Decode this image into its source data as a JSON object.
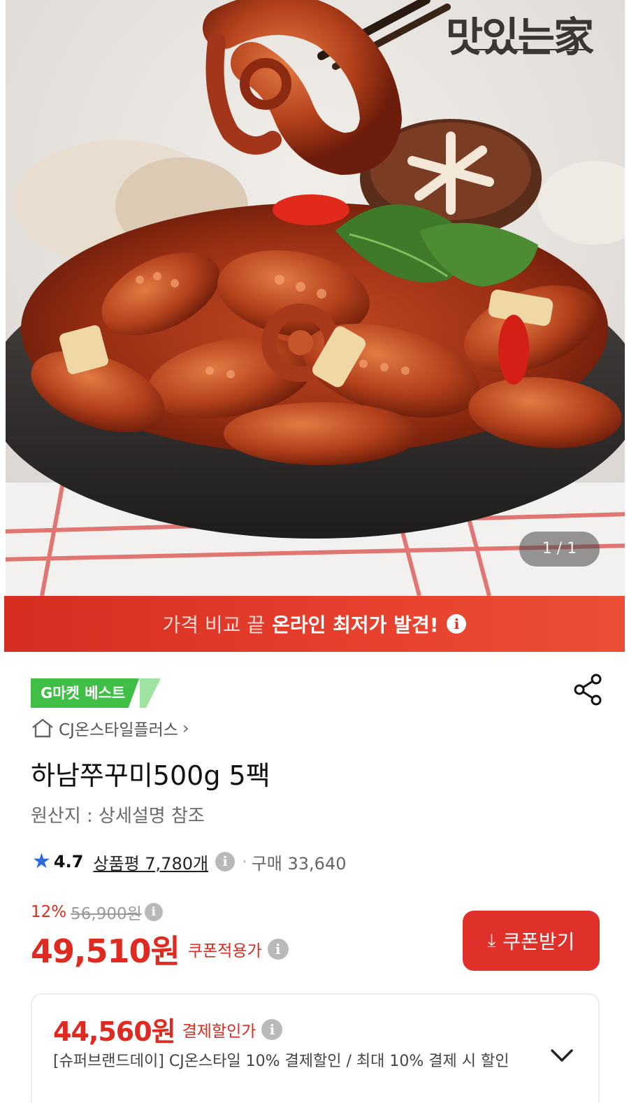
{
  "hero": {
    "brand_logo": "맛있는家",
    "page_counter": "1 / 1"
  },
  "promo": {
    "light_text": "가격 비교 끝",
    "bold_text": "온라인 최저가 발견!",
    "info_glyph": "i"
  },
  "product": {
    "badge": "G마켓 베스트",
    "seller": "CJ온스타일플러스",
    "seller_chevron": "›",
    "title": "하남쭈꾸미500g 5팩",
    "origin": "원산지 : 상세설명 참조",
    "rating": {
      "star": "★",
      "score": "4.7",
      "reviews": "상품평 7,780개",
      "info_glyph": "i",
      "separator": "·",
      "purchases": "구매 33,640"
    },
    "discount": {
      "percent": "12%",
      "original_price": "56,900원",
      "info_glyph": "i"
    },
    "price": {
      "value": "49,510원",
      "note": "쿠폰적용가",
      "info_glyph": "i"
    },
    "coupon_button": {
      "icon": "⤓",
      "label": "쿠폰받기"
    },
    "payment": {
      "price": "44,560원",
      "note": "결제할인가",
      "info_glyph": "i",
      "description": "[슈퍼브랜드데이] CJ온스타일 10% 결제할인 / 최대 10% 결제 시 할인"
    }
  },
  "colors": {
    "accent_red": "#e02a20",
    "badge_green": "#3fbf46",
    "star_blue": "#2c6bd9"
  }
}
